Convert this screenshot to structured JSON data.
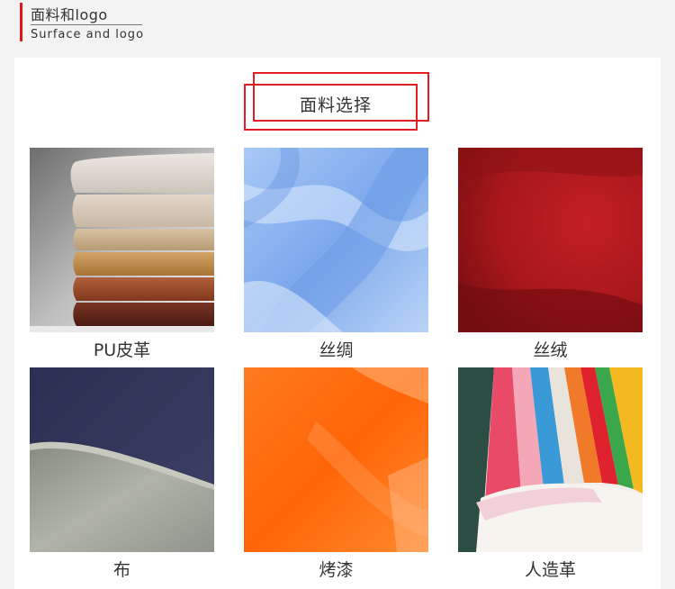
{
  "header": {
    "title_cn": "面料和logo",
    "title_en": "Surface and logo",
    "accent_color": "#e01818"
  },
  "section": {
    "title": "面料选择",
    "frame_color": "#e51c23"
  },
  "fabrics": [
    {
      "label": "PU皮革",
      "swatch": "stacked-pu-leather",
      "colors": [
        "#d9d2ca",
        "#b9875a",
        "#7a3a24"
      ]
    },
    {
      "label": "丝绸",
      "swatch": "blue-silk",
      "colors": [
        "#8fb6ef"
      ]
    },
    {
      "label": "丝绒",
      "swatch": "red-velvet",
      "colors": [
        "#b0181c"
      ]
    },
    {
      "label": "布",
      "swatch": "navy-grey-cloth",
      "colors": [
        "#33375a",
        "#9ea295"
      ]
    },
    {
      "label": "烤漆",
      "swatch": "orange-lacquer",
      "colors": [
        "#ff6a10"
      ]
    },
    {
      "label": "人造革",
      "swatch": "multicolor-faux-leather",
      "colors": [
        "#2b4d43",
        "#e23a55",
        "#3a9ad8",
        "#f4b820"
      ]
    }
  ]
}
